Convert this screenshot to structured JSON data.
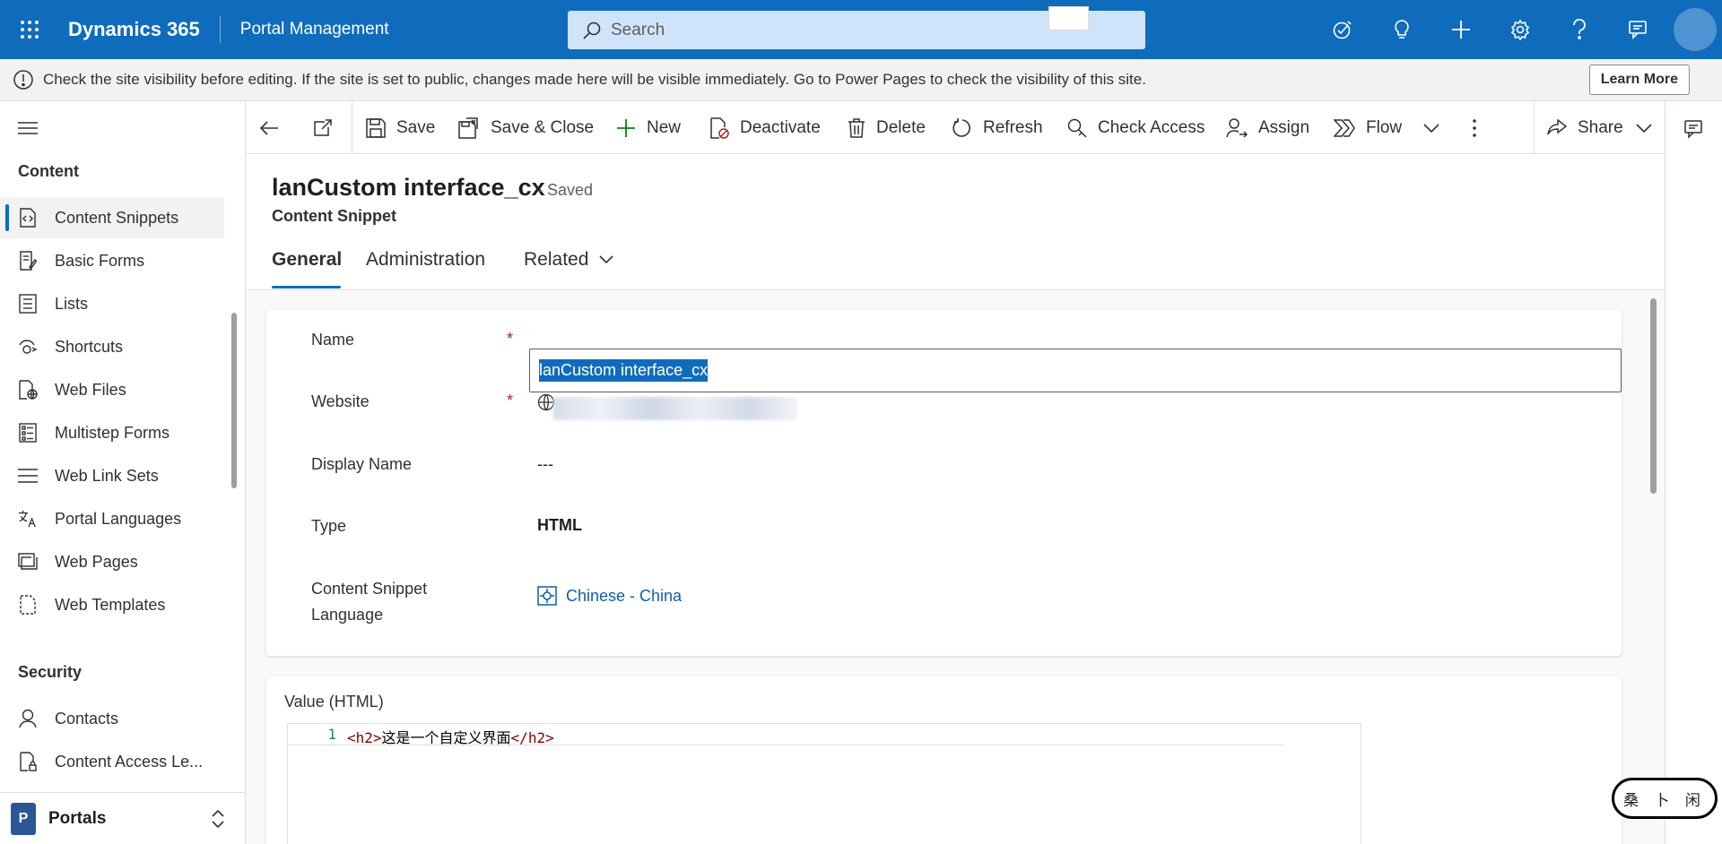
{
  "topbar": {
    "brand": "Dynamics 365",
    "app_name": "Portal Management",
    "search_placeholder": "Search",
    "icons": [
      "waffle-icon",
      "search-icon",
      "task-flow-icon",
      "lightbulb-icon",
      "plus-icon",
      "settings-icon",
      "help-icon",
      "chat-icon",
      "avatar"
    ]
  },
  "notice": {
    "text": "Check the site visibility before editing. If the site is set to public, changes made here will be visible immediately. Go to Power Pages to check the visibility of this site.",
    "button": "Learn More"
  },
  "sidebar": {
    "groups": [
      {
        "title": "Content",
        "items": [
          {
            "label": "Content Snippets",
            "icon": "snippet-icon",
            "selected": true
          },
          {
            "label": "Basic Forms",
            "icon": "form-icon"
          },
          {
            "label": "Lists",
            "icon": "list-icon"
          },
          {
            "label": "Shortcuts",
            "icon": "shortcut-icon"
          },
          {
            "label": "Web Files",
            "icon": "web-file-icon"
          },
          {
            "label": "Multistep Forms",
            "icon": "multistep-icon"
          },
          {
            "label": "Web Link Sets",
            "icon": "link-set-icon"
          },
          {
            "label": "Portal Languages",
            "icon": "language-icon"
          },
          {
            "label": "Web Pages",
            "icon": "web-page-icon"
          },
          {
            "label": "Web Templates",
            "icon": "template-icon"
          }
        ]
      },
      {
        "title": "Security",
        "items": [
          {
            "label": "Contacts",
            "icon": "person-icon"
          },
          {
            "label": "Content Access Le...",
            "icon": "access-icon"
          }
        ]
      }
    ],
    "area": {
      "badge": "P",
      "label": "Portals"
    }
  },
  "commandbar": {
    "save": "Save",
    "save_close": "Save & Close",
    "new": "New",
    "deactivate": "Deactivate",
    "delete": "Delete",
    "refresh": "Refresh",
    "check_access": "Check Access",
    "assign": "Assign",
    "flow": "Flow",
    "share": "Share"
  },
  "record": {
    "title": "lanCustom interface_cx",
    "status": "- Saved",
    "entity": "Content Snippet",
    "tabs": [
      "General",
      "Administration",
      "Related"
    ]
  },
  "form": {
    "name_label": "Name",
    "name_value": "lanCustom interface_cx",
    "website_label": "Website",
    "display_name_label": "Display Name",
    "display_name_value": "---",
    "type_label": "Type",
    "type_value": "HTML",
    "language_label_line1": "Content Snippet",
    "language_label_line2": "Language",
    "language_value": "Chinese - China",
    "required_marker": "*"
  },
  "value_section": {
    "label": "Value (HTML)",
    "line_number": "1",
    "code_open_tag": "<h2>",
    "code_text": "这是一个自定义界面",
    "code_close_tag": "</h2>"
  },
  "colors": {
    "brand_blue": "#0f6cbd",
    "link_blue": "#115ea3",
    "required_red": "#a4262c"
  }
}
